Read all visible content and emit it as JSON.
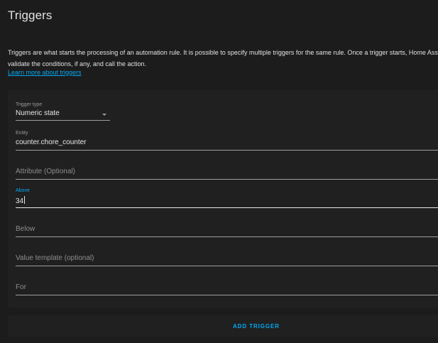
{
  "section": {
    "title": "Triggers",
    "description_lines": [
      "Triggers are what starts the processing of an automation rule. It is possible to specify multiple triggers for the same rule. Once a trigger starts, Home Assistant will",
      "validate the conditions, if any, and call the action."
    ],
    "learn_more_label": "Learn more about triggers"
  },
  "trigger": {
    "type_label": "Trigger type",
    "type_value": "Numeric state",
    "entity_label": "Entity",
    "entity_value": "counter.chore_counter",
    "attribute_placeholder": "Attribute (Optional)",
    "above_label": "Above",
    "above_value": "34",
    "below_placeholder": "Below",
    "value_template_placeholder": "Value template (optional)",
    "for_placeholder": "For"
  },
  "actions": {
    "add_trigger_label": "ADD TRIGGER"
  },
  "colors": {
    "background": "#1c1c1c",
    "card": "#202020",
    "accent": "#03a9f4",
    "text": "#e1e1e1",
    "underline": "#9e9e9e"
  },
  "icons": {
    "dropdown": "chevron-down-icon"
  }
}
